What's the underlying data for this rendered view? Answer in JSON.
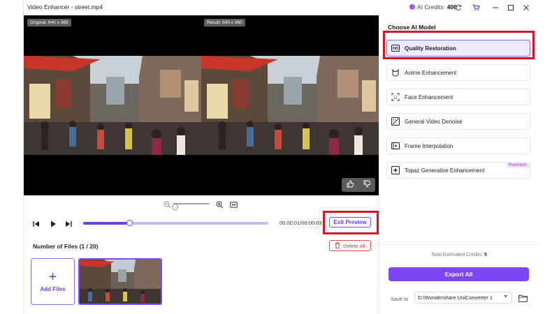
{
  "window": {
    "title": "Video Enhancer - street.mp4",
    "credits_label": "AI Credits:",
    "credits_value": "406"
  },
  "preview": {
    "original_label": "Original: 640 x 360",
    "result_label": "Result: 640 x 360"
  },
  "playback": {
    "timecode": "00:00:01/00:00:03",
    "progress_fraction": 0.25,
    "zoom_fraction": 0.0
  },
  "exit_preview_label": "Exit Preview",
  "files": {
    "title": "Number of Files (1 / 20)",
    "delete_all_label": "Delete All",
    "add_files_label": "Add Files"
  },
  "ai_model": {
    "title": "Choose AI Model",
    "models": [
      {
        "label": "Quality Restoration",
        "icon": "hd-icon",
        "selected": true
      },
      {
        "label": "Anime Enhancement",
        "icon": "anime-icon"
      },
      {
        "label": "Face Enhancement",
        "icon": "face-scan-icon"
      },
      {
        "label": "General Video Denoise",
        "icon": "denoise-icon"
      },
      {
        "label": "Frame Interpolation",
        "icon": "frame-icon"
      },
      {
        "label": "Topaz Generative Enhancement",
        "icon": "sparkle-icon",
        "badge": "Premium"
      }
    ]
  },
  "export": {
    "est_label": "Total Estimated Credits:",
    "est_value": "5",
    "button_label": "Export All",
    "save_to_label": "Save to",
    "save_to_path": "D:\\Wondershare UniConverter 1"
  },
  "colors": {
    "accent": "#7e45f5",
    "highlight_box": "#d9152b",
    "delete": "#d83a3a"
  }
}
